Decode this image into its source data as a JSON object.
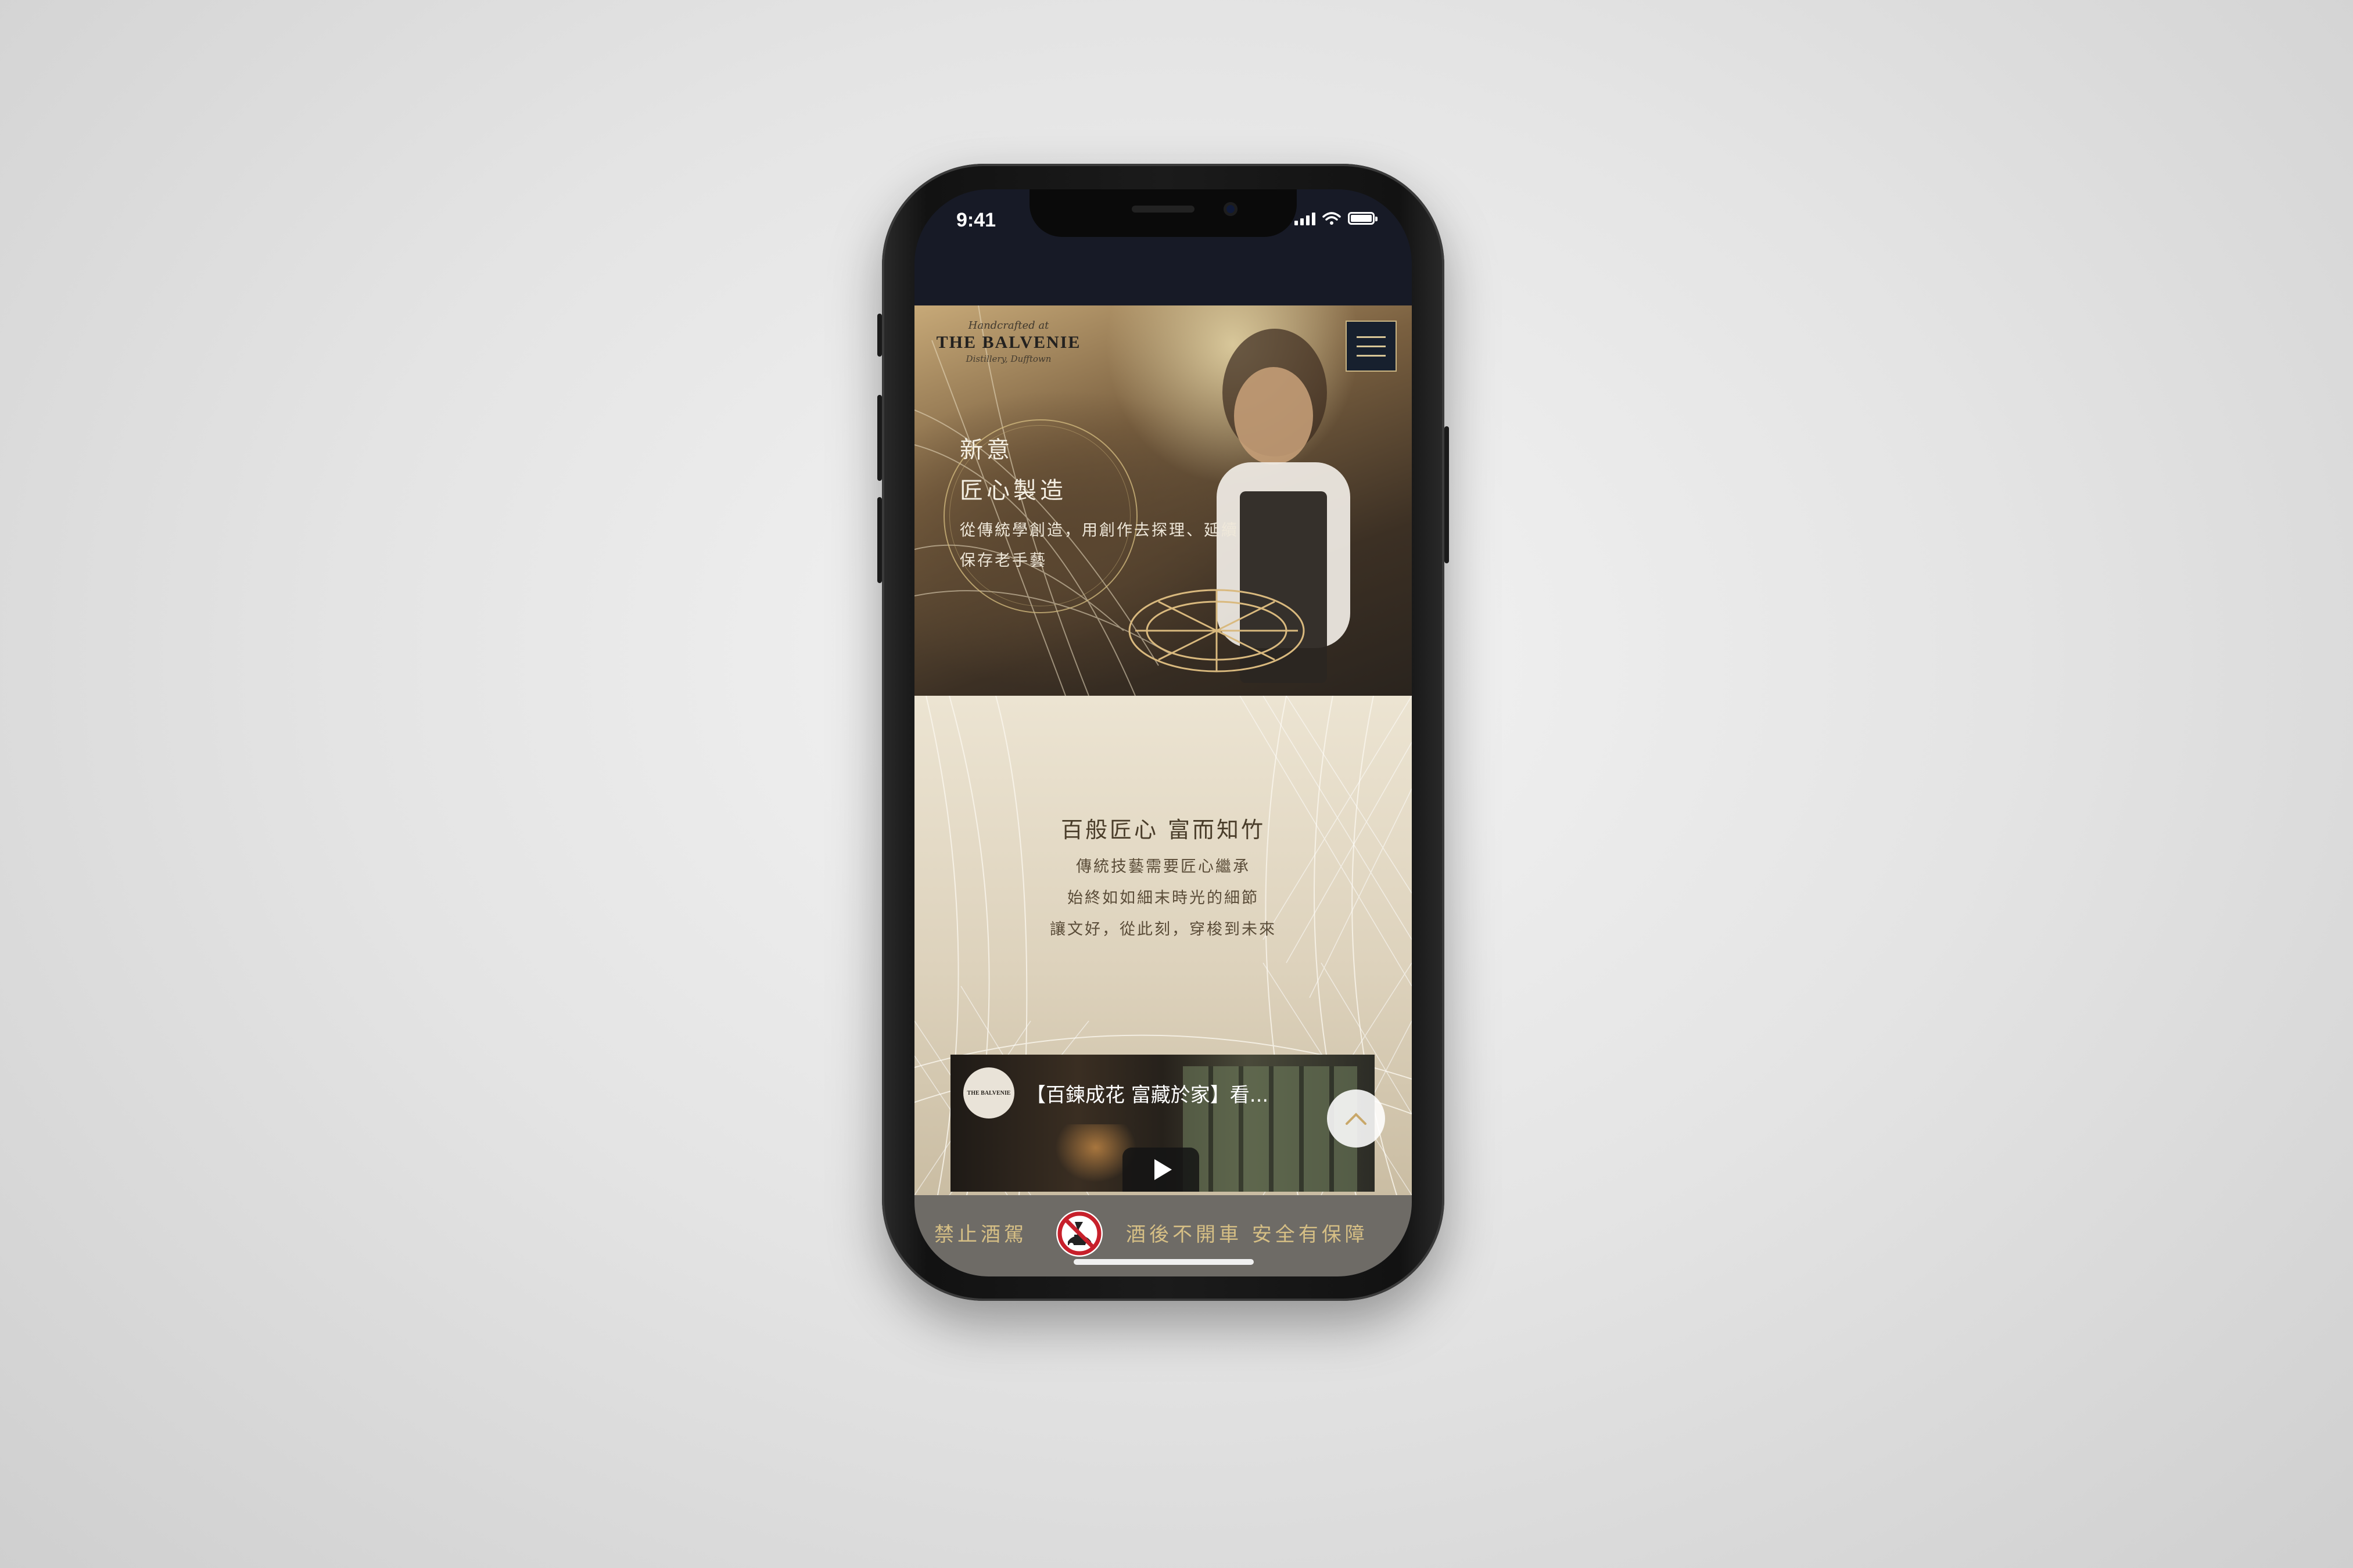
{
  "status_bar": {
    "time": "9:41"
  },
  "header": {
    "logo": {
      "script_line": "Handcrafted at",
      "brand": "THE BALVENIE",
      "sub_line": "Distillery, Dufftown"
    }
  },
  "hero": {
    "title_line1": "新意",
    "title_line2": "匠心製造",
    "desc_line1": "從傳統學創造，用創作去探理、延續",
    "desc_line2": "保存老手藝"
  },
  "craft": {
    "title": "百般匠心 富而知竹",
    "lines": [
      "傳統技藝需要匠心繼承",
      "始終如如細末時光的細節",
      "讓文好，從此刻，穿梭到未來"
    ]
  },
  "video": {
    "channel_logo_text": "THE BALVENIE",
    "title": "【百鍊成花 富藏於家】看..."
  },
  "footer": {
    "left_text": "禁止酒駕",
    "right_text": "酒後不開車 安全有保障"
  },
  "colors": {
    "accent_gold": "#d6bf85",
    "nav_dark": "#17202e",
    "footer_bg": "#6e6b66"
  }
}
